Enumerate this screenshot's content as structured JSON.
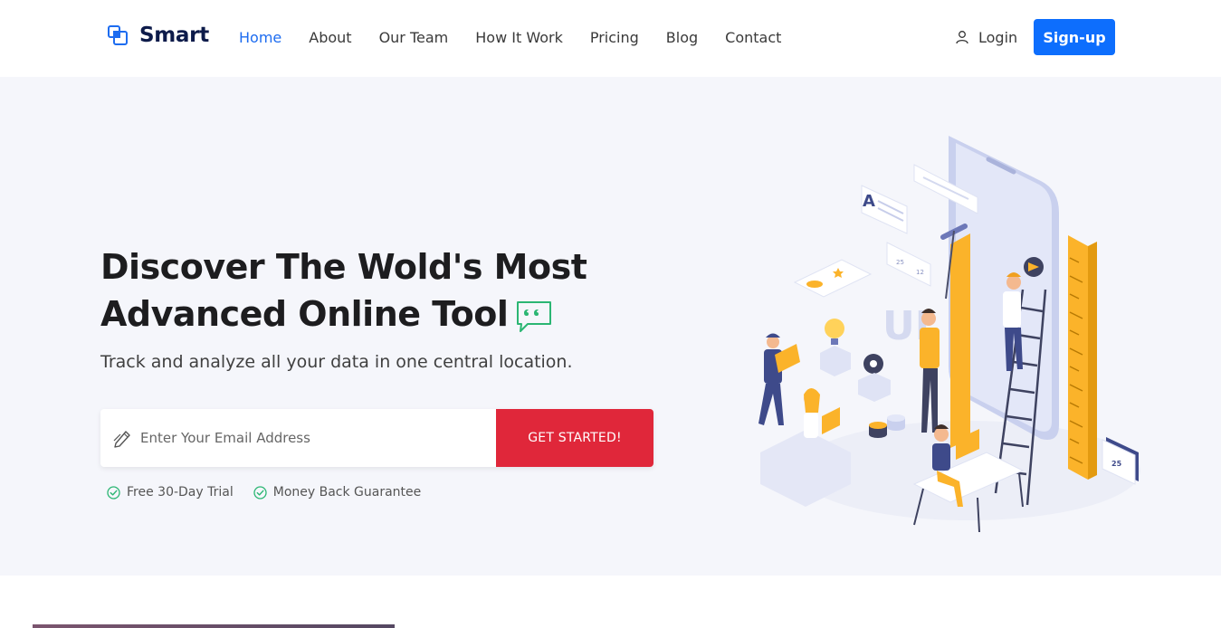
{
  "brand": {
    "name": "Smart"
  },
  "nav": {
    "items": [
      {
        "label": "Home",
        "active": true
      },
      {
        "label": "About"
      },
      {
        "label": "Our Team"
      },
      {
        "label": "How It Work"
      },
      {
        "label": "Pricing"
      },
      {
        "label": "Blog"
      },
      {
        "label": "Contact"
      }
    ],
    "login_label": "Login",
    "signup_label": "Sign-up"
  },
  "hero": {
    "headline_line1": "Discover The Wold's Most",
    "headline_line2": "Advanced Online Tool",
    "subtitle": "Track and analyze all your data in one central location.",
    "email_placeholder": "Enter Your Email Address",
    "cta_label": "GET STARTED!",
    "benefits": [
      "Free 30-Day Trial",
      "Money Back Guarantee"
    ]
  },
  "illustration": {
    "ui_letters": "UI",
    "letter_a": "A",
    "ruler_number": "25",
    "card_counts": [
      "25",
      "12"
    ]
  },
  "colors": {
    "primary": "#0d6efd",
    "brand_blue": "#1d6cf0",
    "cta_red": "#e0273a",
    "check_green": "#2bb673",
    "hero_bg": "#f5f6fb",
    "accent_yellow": "#fbb32a"
  }
}
